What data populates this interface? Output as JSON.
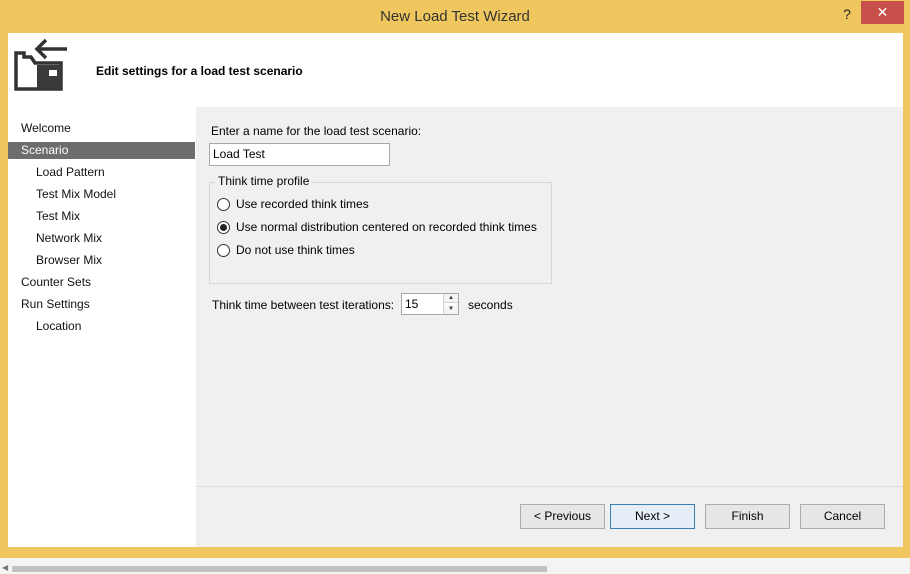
{
  "window": {
    "title": "New Load Test Wizard",
    "help_glyph": "?",
    "close_glyph": "✕"
  },
  "header": {
    "text": "Edit settings for a load test scenario",
    "icon": "wizard-folder-icon"
  },
  "nav": {
    "items": [
      {
        "label": "Welcome",
        "level": 0,
        "selected": false
      },
      {
        "label": "Scenario",
        "level": 0,
        "selected": true
      },
      {
        "label": "Load Pattern",
        "level": 1,
        "selected": false
      },
      {
        "label": "Test Mix Model",
        "level": 1,
        "selected": false
      },
      {
        "label": "Test Mix",
        "level": 1,
        "selected": false
      },
      {
        "label": "Network Mix",
        "level": 1,
        "selected": false
      },
      {
        "label": "Browser Mix",
        "level": 1,
        "selected": false
      },
      {
        "label": "Counter Sets",
        "level": 0,
        "selected": false
      },
      {
        "label": "Run Settings",
        "level": 0,
        "selected": false
      },
      {
        "label": "Location",
        "level": 1,
        "selected": false
      }
    ]
  },
  "scenario": {
    "name_label": "Enter a name for the load test scenario:",
    "name_value": "Load Test",
    "think_group_title": "Think time profile",
    "options": [
      {
        "label": "Use recorded think times",
        "checked": false
      },
      {
        "label": "Use normal distribution centered on recorded think times",
        "checked": true
      },
      {
        "label": "Do not use think times",
        "checked": false
      }
    ],
    "iterations_label": "Think time between test iterations:",
    "iterations_value": "15",
    "iterations_unit": "seconds"
  },
  "buttons": {
    "previous": "< Previous",
    "next": "Next >",
    "finish": "Finish",
    "cancel": "Cancel"
  },
  "colors": {
    "frame": "#f0c75e",
    "close": "#c7504a",
    "selected_nav": "#6d6d6d"
  }
}
